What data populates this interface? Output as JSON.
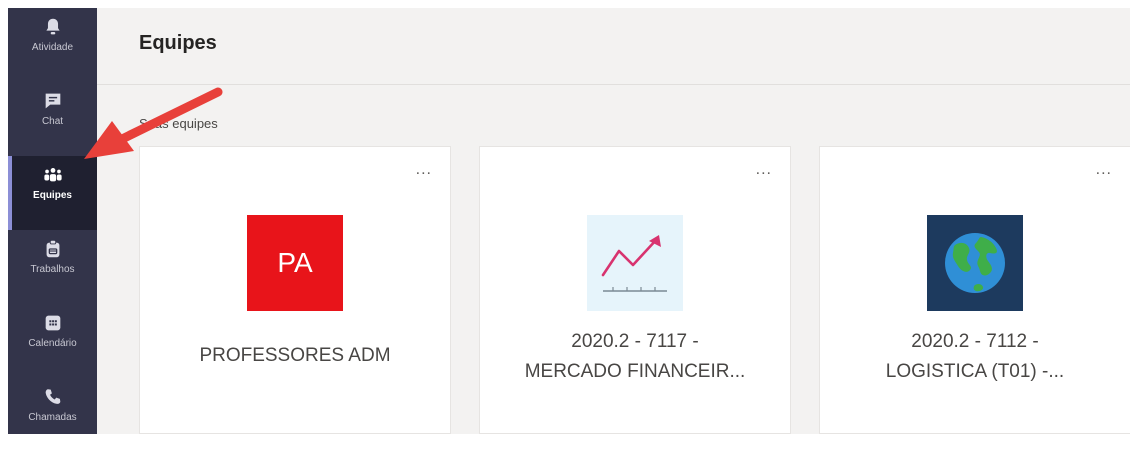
{
  "rail": {
    "items": [
      {
        "label": "Atividade",
        "icon": "bell-icon"
      },
      {
        "label": "Chat",
        "icon": "chat-icon"
      },
      {
        "label": "Equipes",
        "icon": "teams-icon",
        "active": true
      },
      {
        "label": "Trabalhos",
        "icon": "assignments-icon"
      },
      {
        "label": "Calendário",
        "icon": "calendar-icon"
      },
      {
        "label": "Chamadas",
        "icon": "phone-icon"
      }
    ]
  },
  "header": {
    "title": "Equipes"
  },
  "section": {
    "label": "Suas equipes"
  },
  "teams": [
    {
      "avatar_text": "PA",
      "avatar_color": "#e8141a",
      "name_line1": "PROFESSORES ADM",
      "name_line2": "",
      "more": "..."
    },
    {
      "avatar_icon": "rising-chart-icon",
      "name_line1": "2020.2 - 7117 -",
      "name_line2": "MERCADO FINANCEIR...",
      "more": "..."
    },
    {
      "avatar_icon": "globe-icon",
      "name_line1": "2020.2 - 7112 -",
      "name_line2": "LOGISTICA (T01) -...",
      "more": "..."
    }
  ],
  "colors": {
    "rail": "#33344a",
    "accent": "#8c8fd6",
    "annotation_arrow": "#e8403a"
  }
}
